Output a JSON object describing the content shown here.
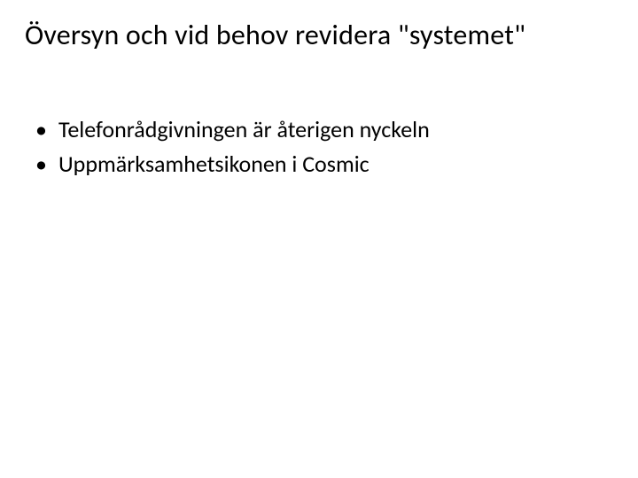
{
  "slide": {
    "title": "Översyn och vid behov revidera \"systemet\"",
    "bullets": [
      "Telefonrådgivningen är återigen nyckeln",
      "Uppmärksamhetsikonen i Cosmic"
    ]
  }
}
